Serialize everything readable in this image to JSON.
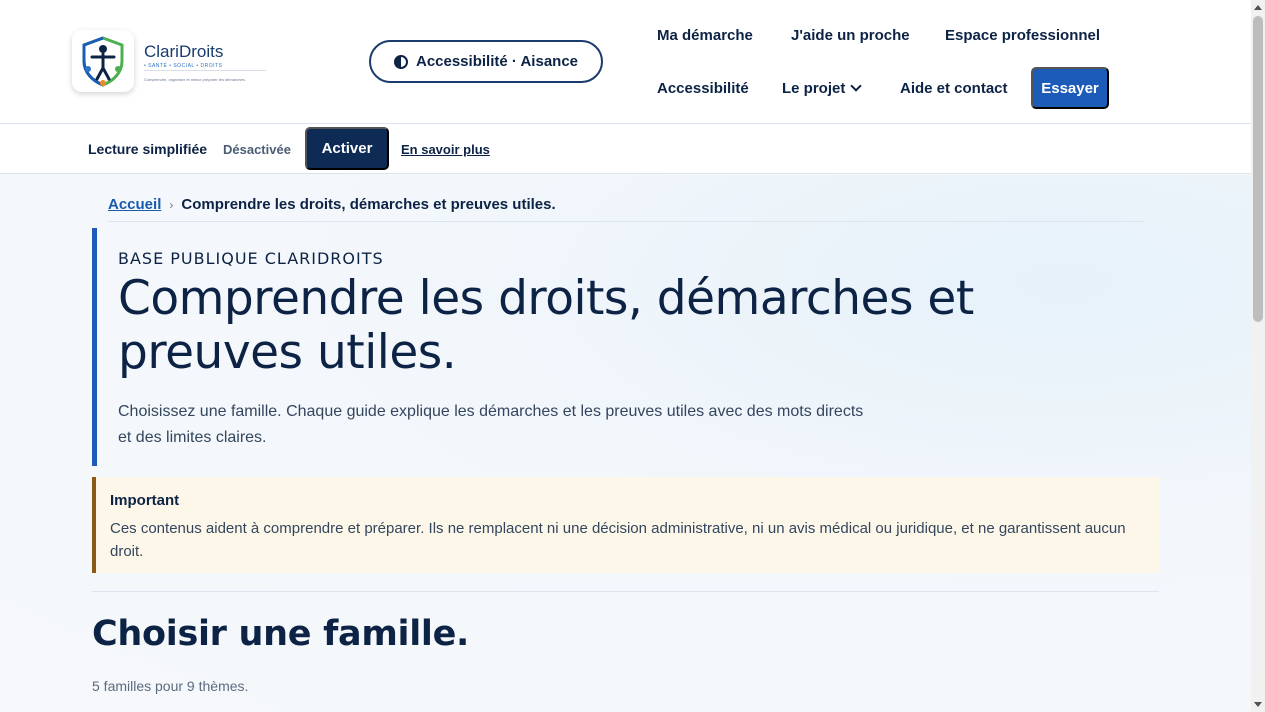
{
  "header": {
    "brand_name": "ClariDroits",
    "brand_tags": "• SANTÉ   • SOCIAL   • DROITS",
    "brand_tagline": "Comprendre, organiser et mieux préparer les démarches.",
    "accessibility_button": "Accessibilité · Aisance",
    "nav": {
      "ma_demarche": "Ma démarche",
      "j_aide": "J'aide un proche",
      "espace_pro": "Espace professionnel",
      "accessibilite": "Accessibilité",
      "le_projet": "Le projet",
      "aide_contact": "Aide et contact"
    },
    "cta": "Essayer"
  },
  "simple_reading": {
    "label": "Lecture simplifiée",
    "state": "Désactivée",
    "activate": "Activer",
    "learn_more": "En savoir plus"
  },
  "breadcrumb": {
    "home": "Accueil",
    "separator": "›",
    "current": "Comprendre les droits, démarches et preuves utiles."
  },
  "hero": {
    "kicker": "BASE PUBLIQUE CLARIDROITS",
    "title": "Comprendre les droits, démarches et preuves utiles.",
    "description": "Choisissez une famille. Chaque guide explique les démarches et les preuves utiles avec des mots directs et des limites claires."
  },
  "notice": {
    "title": "Important",
    "text": "Ces contenus aident à comprendre et préparer. Ils ne remplacent ni une décision administrative, ni un avis médical ou juridique, et ne garantissent aucun droit."
  },
  "families": {
    "title": "Choisir une famille.",
    "subtitle": "5 familles pour 9 thèmes."
  },
  "colors": {
    "primary": "#1c5bb8",
    "navy": "#0d2345",
    "notice_bg": "#fdf7ea",
    "notice_border": "#8a5a14"
  }
}
